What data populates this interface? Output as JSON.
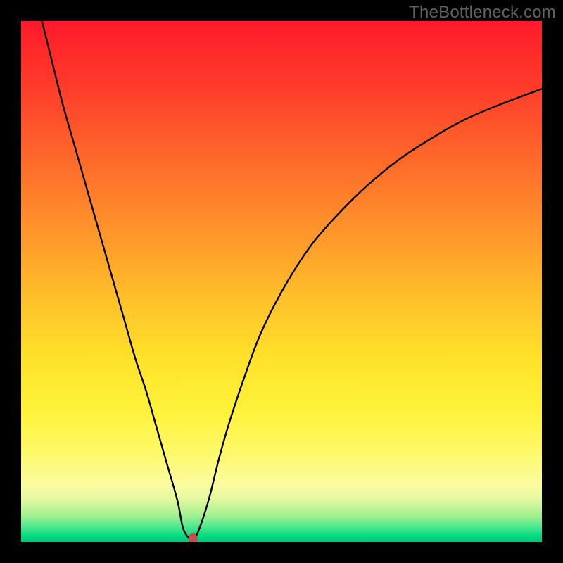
{
  "watermark": "TheBottleneck.com",
  "chart_data": {
    "type": "line",
    "title": "",
    "xlabel": "",
    "ylabel": "",
    "xlim": [
      0,
      100
    ],
    "ylim": [
      0,
      100
    ],
    "grid": false,
    "legend": false,
    "series": [
      {
        "name": "bottleneck-curve",
        "x": [
          4,
          6,
          8,
          10,
          12,
          14,
          16,
          18,
          20,
          22,
          24,
          26,
          28,
          30,
          31,
          32,
          33,
          34,
          36,
          38,
          40,
          43,
          46,
          50,
          55,
          60,
          66,
          72,
          78,
          85,
          92,
          100
        ],
        "values": [
          100,
          92,
          84,
          77,
          70,
          63,
          56,
          49,
          42,
          35,
          29,
          22,
          15,
          8,
          3,
          1,
          0.5,
          2,
          8,
          16,
          23,
          32,
          40,
          48,
          56,
          62,
          68,
          73,
          77,
          81,
          84,
          87
        ]
      }
    ],
    "marker": {
      "name": "optimal-point",
      "x": 33,
      "y": 0.5,
      "rx": 0.9,
      "ry": 1.2,
      "color": "#c54f4b"
    },
    "background": "rainbow-vertical-gradient"
  }
}
